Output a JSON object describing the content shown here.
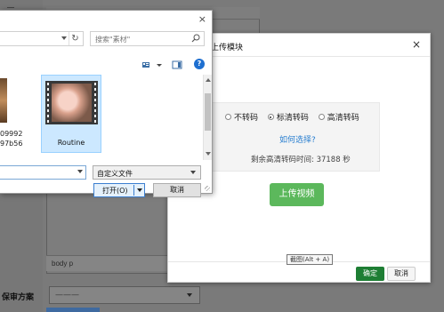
{
  "background": {
    "statusbar_path": "body  p",
    "field_label": "保审方案",
    "select_value": "———"
  },
  "upload_modal": {
    "title": "上传视频",
    "title_visible": "上传模块",
    "close_glyph": "×",
    "options": [
      {
        "label": "不转码",
        "selected": false
      },
      {
        "label": "标清转码",
        "selected": true
      },
      {
        "label": "高清转码",
        "selected": false
      }
    ],
    "help_link": "如何选择?",
    "remaining_text": "剩余高清转码时间: 37188 秒",
    "upload_button": "上传视频",
    "ok_button": "确定",
    "cancel_button": "取消",
    "tooltip": "截图(Alt + A)"
  },
  "file_dialog": {
    "close_glyph": "×",
    "refresh_glyph": "↻",
    "search_placeholder": "搜索\"素材\"",
    "help_glyph": "?",
    "files": [
      {
        "name": "09992\n97b56",
        "selected": false
      },
      {
        "name": "Routine",
        "selected": true
      }
    ],
    "filename_value": "",
    "filetype_value": "自定义文件",
    "open_button": "打开(O)",
    "cancel_button": "取消"
  },
  "colors": {
    "primary_green": "#5cb85c",
    "ok_green": "#1e7e34",
    "link_blue": "#2a7fd0",
    "selection_blue": "#cce8ff"
  }
}
